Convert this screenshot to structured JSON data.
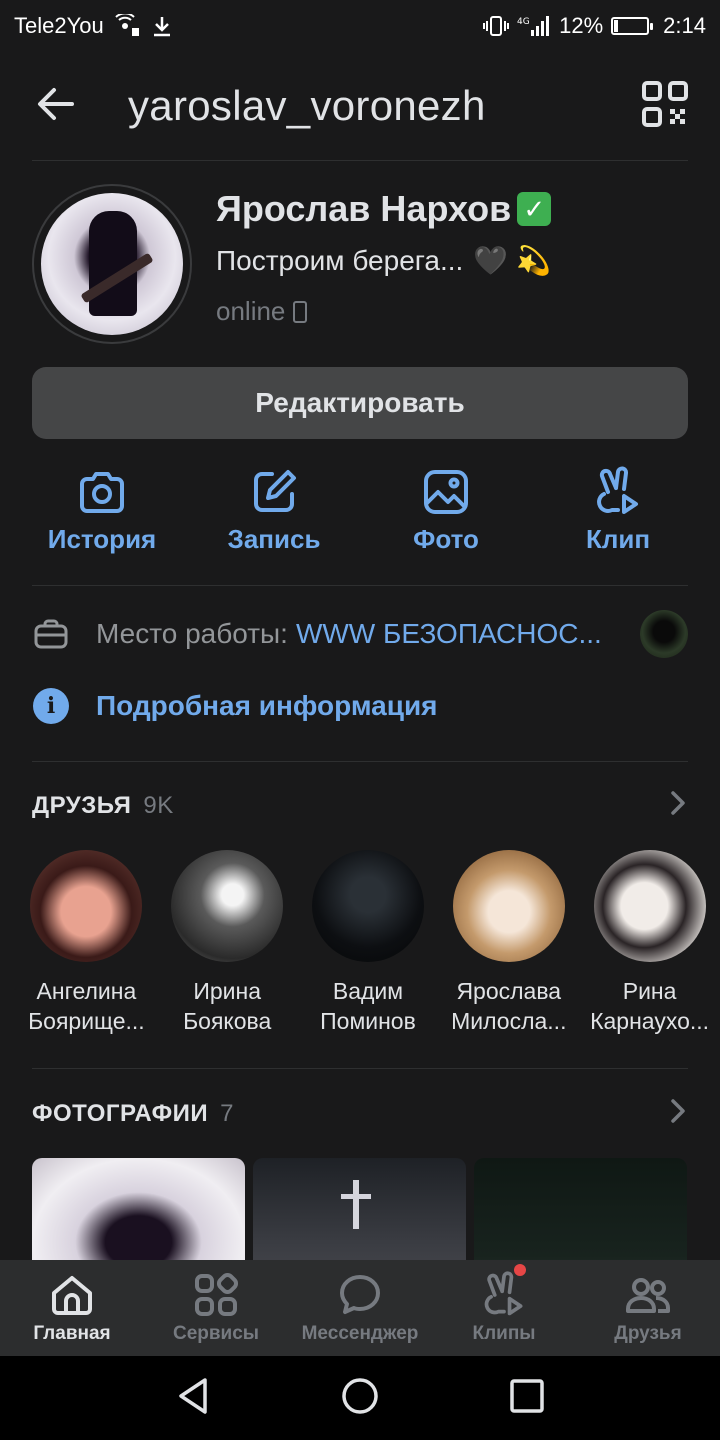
{
  "status_bar": {
    "carrier": "Tele2You",
    "network": "4G",
    "battery": "12%",
    "battery_level": 0.12,
    "time": "2:14"
  },
  "header": {
    "title": "yaroslav_voronezh",
    "back_icon": "arrow-left-icon",
    "qr_icon": "qr-code-icon"
  },
  "profile": {
    "name": "Ярослав Нархов",
    "verified_emoji": "✅",
    "status_text": "Построим берега...",
    "status_emojis": "🖤 💫",
    "online": "online",
    "edit_label": "Редактировать"
  },
  "actions": [
    {
      "label": "История",
      "icon": "camera-icon"
    },
    {
      "label": "Запись",
      "icon": "edit-icon"
    },
    {
      "label": "Фото",
      "icon": "photo-icon"
    },
    {
      "label": "Клип",
      "icon": "clip-icon"
    }
  ],
  "info": {
    "work_label": "Место работы:",
    "work_value": "WWW БЕЗОПАСНОС...",
    "more_label": "Подробная информация"
  },
  "friends": {
    "title": "ДРУЗЬЯ",
    "count": "9K",
    "items": [
      {
        "first": "Ангелина",
        "last": "Боярище..."
      },
      {
        "first": "Ирина",
        "last": "Боякова"
      },
      {
        "first": "Вадим",
        "last": "Поминов"
      },
      {
        "first": "Ярослава",
        "last": "Милосла..."
      },
      {
        "first": "Рина",
        "last": "Карнаухо..."
      }
    ]
  },
  "photos": {
    "title": "ФОТОГРАФИИ",
    "count": "7"
  },
  "tabbar": [
    {
      "label": "Главная",
      "icon": "home-icon",
      "active": true
    },
    {
      "label": "Сервисы",
      "icon": "services-icon",
      "active": false
    },
    {
      "label": "Мессенджер",
      "icon": "messenger-icon",
      "active": false
    },
    {
      "label": "Клипы",
      "icon": "clips-icon",
      "active": false
    },
    {
      "label": "Друзья",
      "icon": "friends-icon",
      "active": false
    }
  ],
  "colors": {
    "background": "#19191a",
    "accent": "#71aaeb",
    "muted": "#767a80",
    "button": "#454647",
    "tabbar": "#2c2d2e"
  }
}
